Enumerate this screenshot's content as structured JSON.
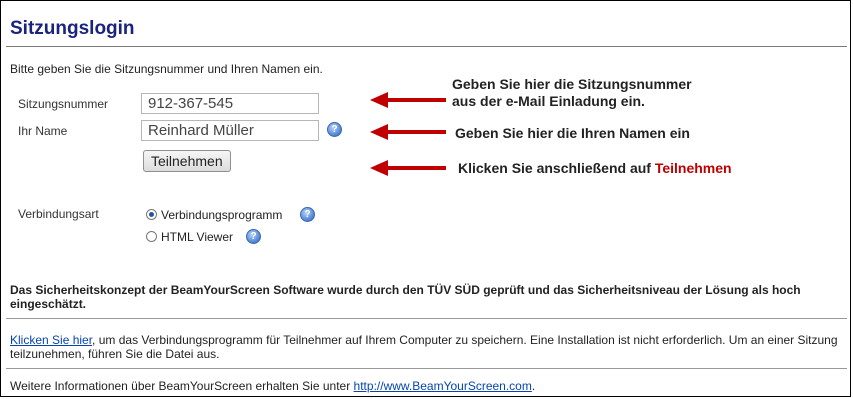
{
  "page_title": "Sitzungslogin",
  "intro": "Bitte geben Sie die Sitzungsnummer und Ihren Namen ein.",
  "form": {
    "session_label": "Sitzungsnummer",
    "session_value": "912-367-545",
    "name_label": "Ihr Name",
    "name_value": "Reinhard Müller",
    "join_button": "Teilnehmen",
    "connection_label": "Verbindungsart",
    "options": [
      {
        "label": "Verbindungsprogramm",
        "checked": true
      },
      {
        "label": "HTML Viewer",
        "checked": false
      }
    ]
  },
  "callouts": {
    "session_line1": "Geben Sie hier die Sitzungsnummer",
    "session_line2": "aus der e-Mail Einladung ein.",
    "name": "Geben Sie hier die Ihren Namen ein",
    "join_prefix": "Klicken Sie anschließend auf ",
    "join_highlight": "Teilnehmen"
  },
  "security_text": "Das Sicherheitskonzept der BeamYourScreen Software wurde durch den TÜV SÜD geprüft und das Sicherheitsniveau der Lösung als hoch eingeschätzt.",
  "download": {
    "link_text": "Klicken Sie hier",
    "text": ", um das Verbindungsprogramm für Teilnehmer auf Ihrem Computer zu speichern. Eine Installation ist nicht erforderlich. Um an einer Sitzung teilzunehmen, führen Sie die Datei aus."
  },
  "info": {
    "text": "Weitere Informationen über BeamYourScreen erhalten Sie unter ",
    "link_text": "http://www.BeamYourScreen.com",
    "suffix": "."
  },
  "icons": {
    "help": "help-question-icon",
    "arrow": "red-arrow-icon"
  },
  "colors": {
    "title": "#1a237e",
    "arrow": "#c00000",
    "highlight": "#c00000",
    "link": "#0645ad"
  }
}
